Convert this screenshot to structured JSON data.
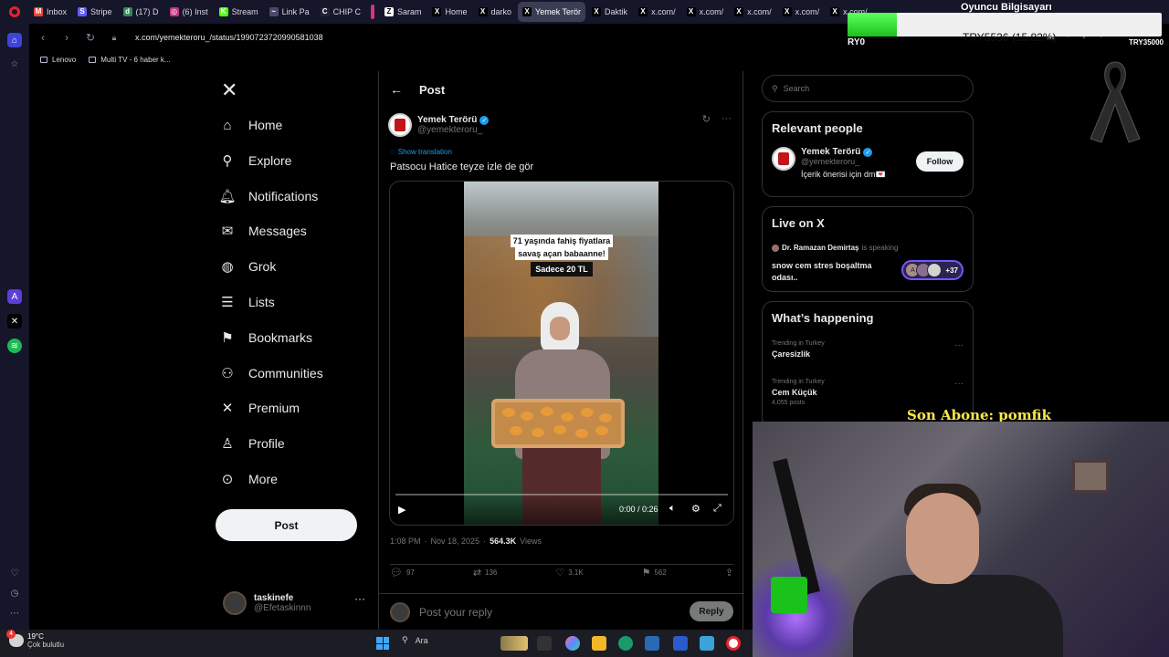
{
  "browser": {
    "tabs": [
      {
        "label": "Inbox",
        "color": "#ea4335",
        "glyph": "M"
      },
      {
        "label": "Stripe",
        "color": "#635bff",
        "glyph": "S"
      },
      {
        "label": "(17) D",
        "color": "#2e8b57",
        "glyph": "d"
      },
      {
        "label": "(6) Inst",
        "color": "#c13584",
        "glyph": "◎"
      },
      {
        "label": "Stream",
        "color": "#53fc18",
        "glyph": "K"
      },
      {
        "label": "Link Pa",
        "color": "#4a4a6a",
        "glyph": "~"
      },
      {
        "label": "CHIP C",
        "color": "#222233",
        "glyph": "C"
      },
      {
        "label": "Saram",
        "color": "#ffffff",
        "glyph": "Z"
      },
      {
        "label": "Home",
        "color": "#000000",
        "glyph": "X"
      },
      {
        "label": "darko",
        "color": "#000000",
        "glyph": "X"
      },
      {
        "label": "Yemek Terör",
        "color": "#000000",
        "glyph": "X",
        "active": true
      },
      {
        "label": "Daktik",
        "color": "#000000",
        "glyph": "X"
      },
      {
        "label": "x.com/",
        "color": "#000000",
        "glyph": "X"
      },
      {
        "label": "x.com/",
        "color": "#000000",
        "glyph": "X"
      },
      {
        "label": "x.com/",
        "color": "#000000",
        "glyph": "X"
      },
      {
        "label": "x.com/",
        "color": "#000000",
        "glyph": "X"
      },
      {
        "label": "x.com/",
        "color": "#000000",
        "glyph": "X"
      }
    ],
    "url": "x.com/yemekteroru_/status/1990723720990581038",
    "bookmarks": [
      {
        "label": "Lenovo"
      },
      {
        "label": "Multi TV - 6 haber k..."
      }
    ]
  },
  "nav": {
    "items": [
      {
        "label": "Home",
        "icon": "home-icon",
        "glyph": "⌂"
      },
      {
        "label": "Explore",
        "icon": "search-icon",
        "glyph": "⚲"
      },
      {
        "label": "Notifications",
        "icon": "bell-icon",
        "glyph": "🔔︎"
      },
      {
        "label": "Messages",
        "icon": "mail-icon",
        "glyph": "✉"
      },
      {
        "label": "Grok",
        "icon": "grok-icon",
        "glyph": "◍"
      },
      {
        "label": "Lists",
        "icon": "list-icon",
        "glyph": "☰"
      },
      {
        "label": "Bookmarks",
        "icon": "bookmark-icon",
        "glyph": "⚑"
      },
      {
        "label": "Communities",
        "icon": "communities-icon",
        "glyph": "⚇"
      },
      {
        "label": "Premium",
        "icon": "x-premium-icon",
        "glyph": "✕"
      },
      {
        "label": "Profile",
        "icon": "person-icon",
        "glyph": "♙"
      },
      {
        "label": "More",
        "icon": "more-circle-icon",
        "glyph": "⊙"
      }
    ],
    "post_button": "Post",
    "account": {
      "name": "taskinefe",
      "handle": "@Efetaskinnn"
    }
  },
  "post": {
    "header_title": "Post",
    "author_name": "Yemek Terörü",
    "author_handle": "@yemekteroru_",
    "translate_label": "Show translation",
    "text": "Patsocu Hatice teyze izle de gör",
    "video": {
      "caption_line1": "71 yaşında fahiş fiyatlara",
      "caption_line2": "savaş açan babaanne!",
      "caption_price": "Sadece 20 TL",
      "time": "0:00 / 0:26",
      "progress": 0
    },
    "time": "1:08 PM",
    "date": "Nov 18, 2025",
    "views_count": "564.3K",
    "views_label": "Views",
    "replies": "97",
    "reposts": "136",
    "likes": "3.1K",
    "bookmarks": "562",
    "reply_placeholder": "Post your reply",
    "reply_button": "Reply"
  },
  "right": {
    "search_placeholder": "Search",
    "relevant_title": "Relevant people",
    "relevant_person": {
      "name": "Yemek Terörü",
      "handle": "@yemekteroru_",
      "bio": "İçerik önerisi için dm💌",
      "follow_label": "Follow"
    },
    "live_title": "Live on X",
    "live": {
      "host": "Dr. Ramazan Demirtaş",
      "host_status": "is speaking",
      "title": "snow cem stres boşaltma odası..",
      "avatar_letter": "A",
      "listener_count": "+37"
    },
    "happening_title": "What’s happening",
    "trends": [
      {
        "context": "Trending in Turkey",
        "name": "Çaresizlik",
        "posts": ""
      },
      {
        "context": "Trending in Turkey",
        "name": "Cem Küçük",
        "posts": "4,055 posts"
      }
    ]
  },
  "overlay": {
    "channel": "Oyuncu Bilgisayarı",
    "goal": "TRY5536 (15.82%)",
    "goal_progress": 0.158,
    "left_label": "RY0",
    "right_label": "TRY35000",
    "last_sub": "Son Abone: pomfik"
  },
  "taskbar": {
    "weather_badge": "4",
    "temp": "19°C",
    "weather_desc": "Çok bulutlu",
    "search_label": "Ara"
  },
  "colors": {
    "accent": "#1d9bf0",
    "background": "#000000",
    "border": "#2f3336",
    "muted_text": "#71767b",
    "goal_fill": "#1cc21c",
    "sub_label": "#f8e84a"
  }
}
